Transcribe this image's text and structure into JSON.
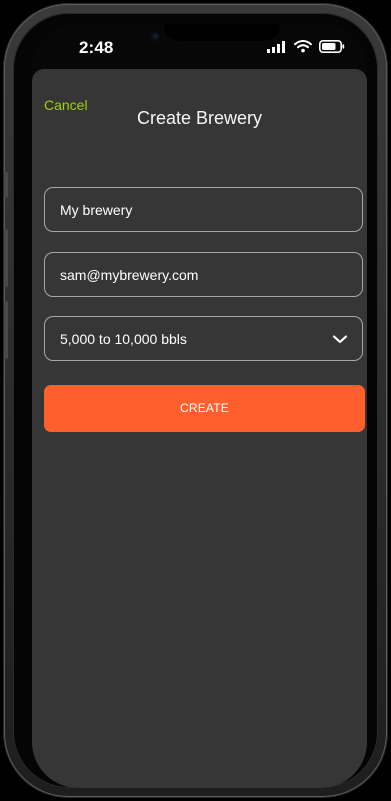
{
  "status_bar": {
    "time": "2:48",
    "camera_icon": "camera-dot",
    "signal_icon": "signal-bars-icon",
    "wifi_icon": "wifi-icon",
    "battery_icon": "battery-icon"
  },
  "header": {
    "cancel_label": "Cancel",
    "title": "Create Brewery"
  },
  "form": {
    "brewery_name_value": "My brewery",
    "email_value": "sam@mybrewery.com",
    "production_volume_value": "5,000 to 10,000 bbls",
    "create_label": "CREATE"
  },
  "colors": {
    "accent": "#ff5f2d",
    "cancel": "#9fd00d",
    "background": "#363636"
  }
}
